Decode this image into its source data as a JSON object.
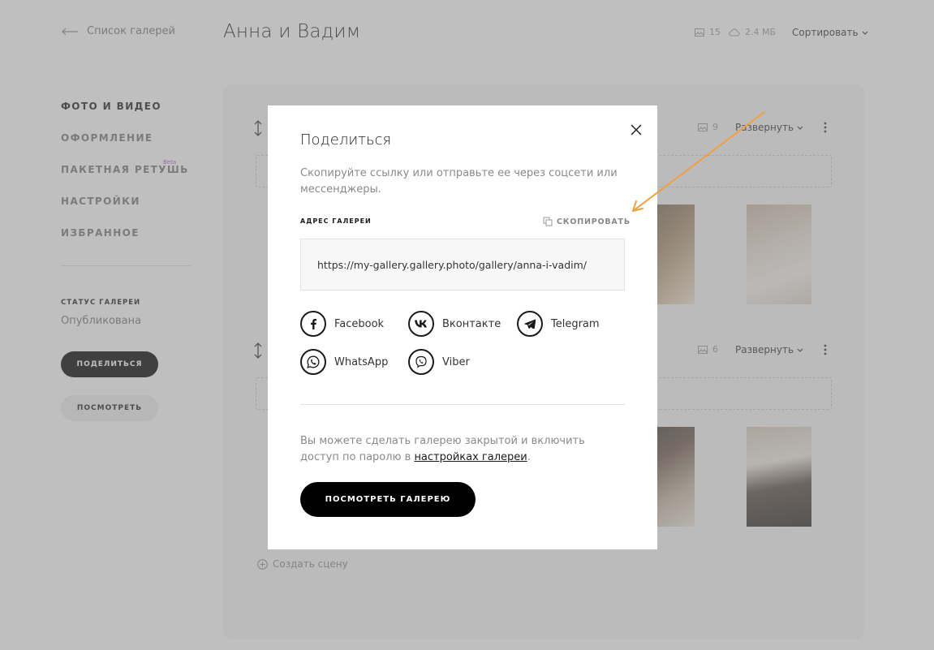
{
  "header": {
    "back_label": "Список галерей",
    "gallery_title": "Анна и Вадим",
    "photo_count": "15",
    "storage": "2.4 МБ",
    "sort_label": "Сортировать"
  },
  "sidebar": {
    "items": [
      {
        "label": "ФОТО И ВИДЕО",
        "active": true
      },
      {
        "label": "ОФОРМЛЕНИЕ"
      },
      {
        "label": "ПАКЕТНАЯ РЕТУШЬ",
        "badge": "Beta"
      },
      {
        "label": "НАСТРОЙКИ"
      },
      {
        "label": "ИЗБРАННОЕ"
      }
    ],
    "status_label": "СТАТУС ГАЛЕРЕИ",
    "status_value": "Опубликована",
    "share_button": "ПОДЕЛИТЬСЯ",
    "view_button": "ПОСМОТРЕТЬ"
  },
  "scenes": [
    {
      "count": "9",
      "expand_label": "Развернуть"
    },
    {
      "count": "6",
      "expand_label": "Развернуть"
    }
  ],
  "create_scene_label": "Создать сцену",
  "modal": {
    "title": "Поделиться",
    "description": "Скопируйте ссылку или отправьте ее через соцсети или мессенджеры.",
    "address_label": "АДРЕС ГАЛЕРЕИ",
    "copy_label": "СКОПИРОВАТЬ",
    "url": "https://my-gallery.gallery.photo/gallery/anna-i-vadim/",
    "socials": [
      {
        "label": "Facebook",
        "icon": "facebook-icon"
      },
      {
        "label": "Вконтакте",
        "icon": "vk-icon"
      },
      {
        "label": "Telegram",
        "icon": "telegram-icon"
      },
      {
        "label": "WhatsApp",
        "icon": "whatsapp-icon"
      },
      {
        "label": "Viber",
        "icon": "viber-icon"
      }
    ],
    "note_prefix": "Вы можете сделать галерею закрытой и включить доступ по паролю в ",
    "note_link": "настройках галереи",
    "note_suffix": ".",
    "view_gallery_button": "ПОСМОТРЕТЬ ГАЛЕРЕЮ"
  },
  "colors": {
    "accent_arrow": "#f0a040",
    "overlay": "#808080",
    "primary_button": "#000000",
    "beta_badge": "#9b59b6"
  }
}
